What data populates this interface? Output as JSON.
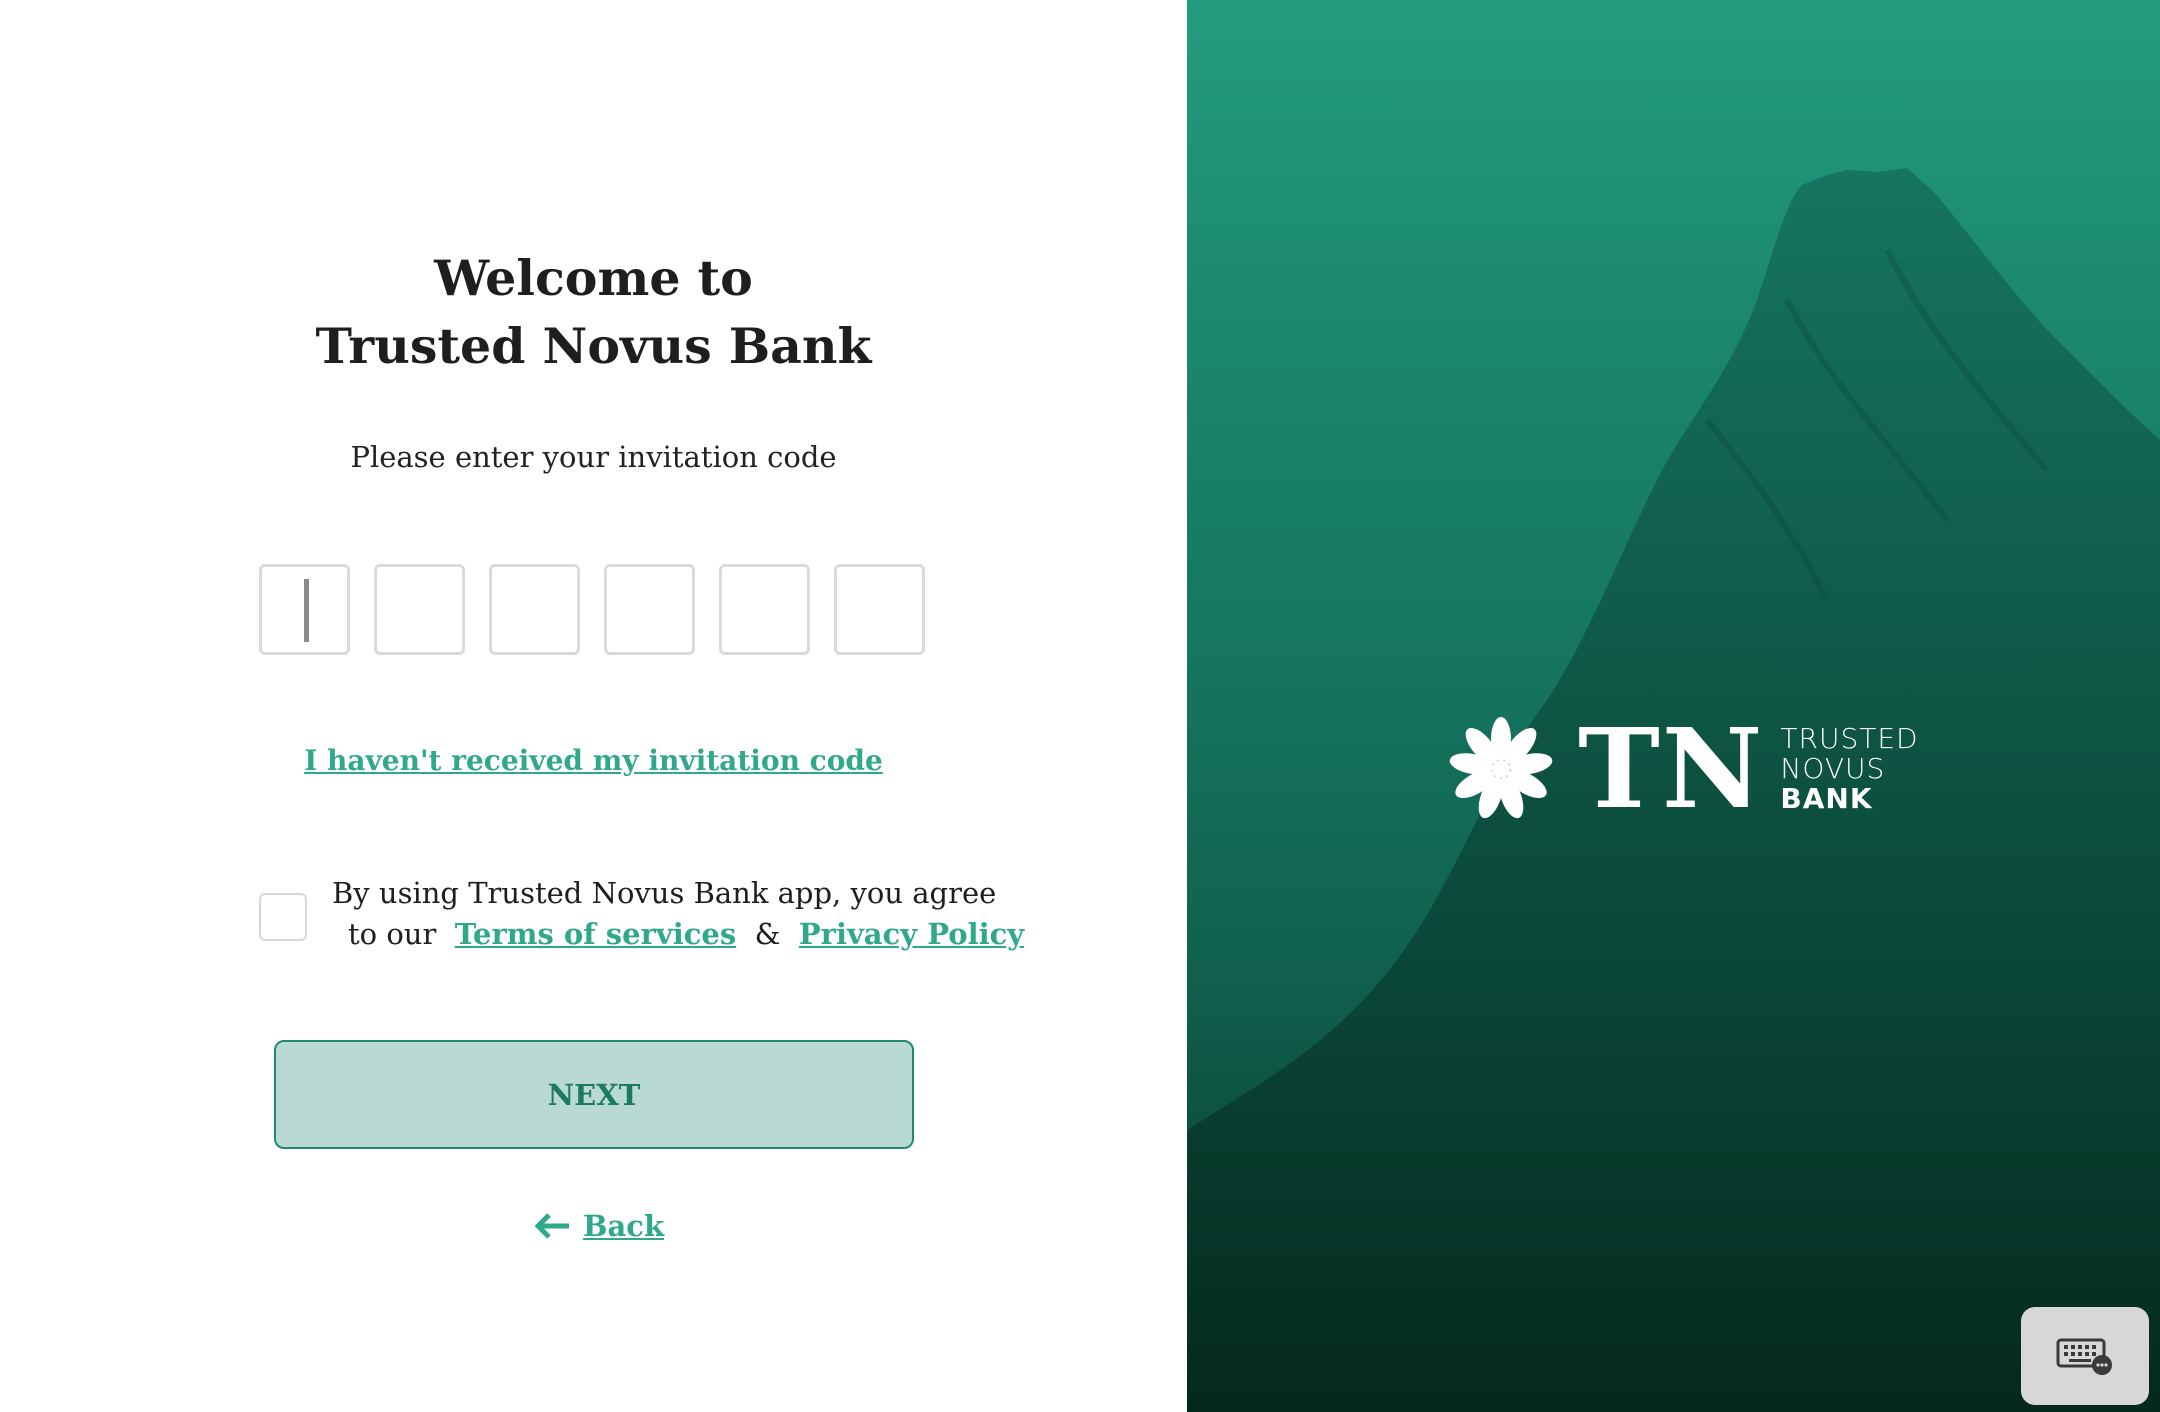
{
  "welcome": {
    "title_line1": "Welcome to",
    "title_line2": "Trusted Novus Bank",
    "subtitle": "Please enter your invitation code"
  },
  "code_inputs": [
    {
      "value": ""
    },
    {
      "value": ""
    },
    {
      "value": ""
    },
    {
      "value": ""
    },
    {
      "value": ""
    },
    {
      "value": ""
    }
  ],
  "no_code_link": "I haven't received my invitation code",
  "agreement": {
    "checked": false,
    "line1": "By using Trusted Novus Bank app, you agree",
    "prefix": "to our",
    "terms_link": "Terms of services",
    "ampersand": "&",
    "privacy_link": "Privacy Policy"
  },
  "next_button": "NEXT",
  "back_link": "Back",
  "brand": {
    "monogram": "TN",
    "word1": "TRUSTED",
    "word2": "NOVUS",
    "word3": "BANK",
    "logo_icon": "flower-icon"
  },
  "colors": {
    "accent": "#2fa98a",
    "button_bg": "#b9dad2",
    "button_text": "#1c7a60",
    "panel_green": "#1c8a70"
  },
  "icons": {
    "back": "arrow-left-icon",
    "keyboard": "keyboard-icon"
  }
}
